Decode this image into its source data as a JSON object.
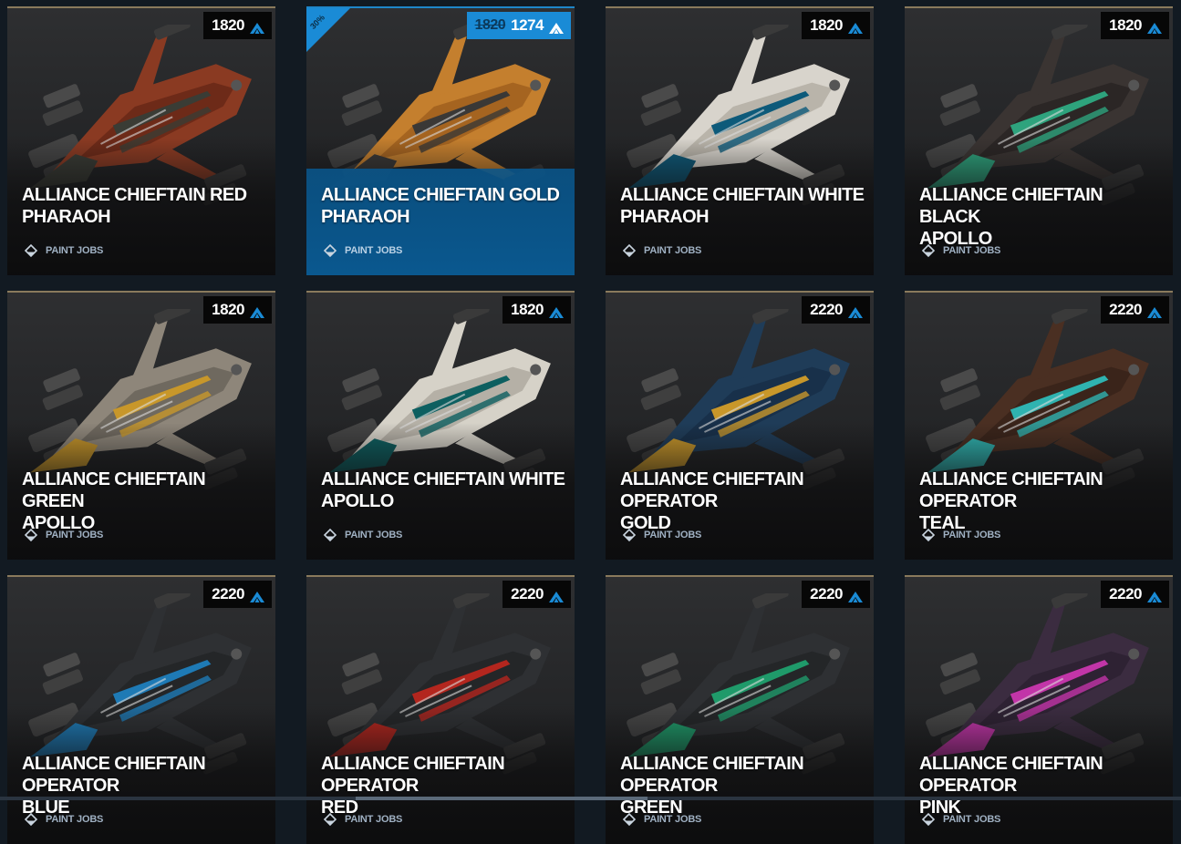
{
  "accent_color": "#1a8bd6",
  "currency_icon": "arx-chevron-icon",
  "category_icon": "paint-bucket-icon",
  "cards": [
    {
      "title_line1": "ALLIANCE CHIEFTAIN RED",
      "title_line2": "PHARAOH",
      "price": "1820",
      "old_price": "",
      "discount": "",
      "category": "PAINT JOBS",
      "primary": "#8a3a22",
      "secondary": "#3a3c35",
      "accent": "#6d2a18",
      "highlight": false
    },
    {
      "title_line1": "ALLIANCE CHIEFTAIN GOLD",
      "title_line2": "PHARAOH",
      "price": "1274",
      "old_price": "1820",
      "discount": "30%",
      "category": "PAINT JOBS",
      "primary": "#c47f2e",
      "secondary": "#3a3836",
      "accent": "#a56420",
      "highlight": true
    },
    {
      "title_line1": "ALLIANCE CHIEFTAIN WHITE",
      "title_line2": "PHARAOH",
      "price": "1820",
      "old_price": "",
      "discount": "",
      "category": "PAINT JOBS",
      "primary": "#d8d4cc",
      "secondary": "#0d5a7a",
      "accent": "#b9b4aa",
      "highlight": false
    },
    {
      "title_line1": "ALLIANCE CHIEFTAIN BLACK",
      "title_line2": "APOLLO",
      "price": "1820",
      "old_price": "",
      "discount": "",
      "category": "PAINT JOBS",
      "primary": "#3a3432",
      "secondary": "#2ea37d",
      "accent": "#2b2625",
      "highlight": false
    },
    {
      "title_line1": "ALLIANCE CHIEFTAIN GREEN",
      "title_line2": "APOLLO",
      "price": "1820",
      "old_price": "",
      "discount": "",
      "category": "PAINT JOBS",
      "primary": "#8e867a",
      "secondary": "#c8972a",
      "accent": "#6f695f",
      "highlight": false
    },
    {
      "title_line1": "ALLIANCE CHIEFTAIN WHITE",
      "title_line2": "APOLLO",
      "price": "1820",
      "old_price": "",
      "discount": "",
      "category": "PAINT JOBS",
      "primary": "#d6d2c8",
      "secondary": "#0d5f60",
      "accent": "#b5b0a6",
      "highlight": false
    },
    {
      "title_line1": "ALLIANCE CHIEFTAIN OPERATOR",
      "title_line2": "GOLD",
      "price": "2220",
      "old_price": "",
      "discount": "",
      "category": "PAINT JOBS",
      "primary": "#1f3c58",
      "secondary": "#c8972a",
      "accent": "#18304a",
      "highlight": false
    },
    {
      "title_line1": "ALLIANCE CHIEFTAIN OPERATOR",
      "title_line2": "TEAL",
      "price": "2220",
      "old_price": "",
      "discount": "",
      "category": "PAINT JOBS",
      "primary": "#4a2f22",
      "secondary": "#2fb3b0",
      "accent": "#3a241a",
      "highlight": false
    },
    {
      "title_line1": "ALLIANCE CHIEFTAIN OPERATOR",
      "title_line2": "BLUE",
      "price": "2220",
      "old_price": "",
      "discount": "",
      "category": "PAINT JOBS",
      "primary": "#2e3033",
      "secondary": "#1e7ab5",
      "accent": "#242628",
      "highlight": false
    },
    {
      "title_line1": "ALLIANCE CHIEFTAIN OPERATOR",
      "title_line2": "RED",
      "price": "2220",
      "old_price": "",
      "discount": "",
      "category": "PAINT JOBS",
      "primary": "#2e3033",
      "secondary": "#b3261e",
      "accent": "#242628",
      "highlight": false
    },
    {
      "title_line1": "ALLIANCE CHIEFTAIN OPERATOR",
      "title_line2": "GREEN",
      "price": "2220",
      "old_price": "",
      "discount": "",
      "category": "PAINT JOBS",
      "primary": "#2e3033",
      "secondary": "#1f9a6a",
      "accent": "#242628",
      "highlight": false
    },
    {
      "title_line1": "ALLIANCE CHIEFTAIN OPERATOR",
      "title_line2": "PINK",
      "price": "2220",
      "old_price": "",
      "discount": "",
      "category": "PAINT JOBS",
      "primary": "#3b2c40",
      "secondary": "#c235a8",
      "accent": "#2e2233",
      "highlight": false
    }
  ]
}
